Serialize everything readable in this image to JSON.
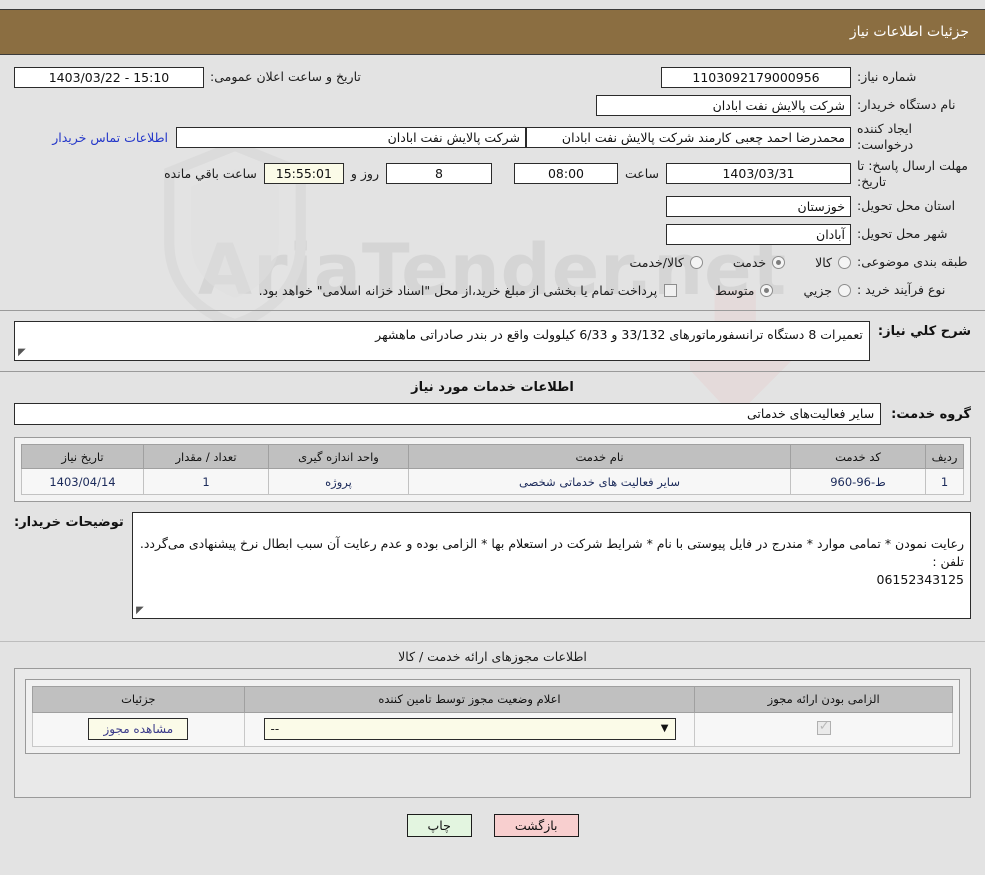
{
  "header": {
    "title": "جزئیات اطلاعات نیاز"
  },
  "watermark": {
    "text": "AriaTender.net"
  },
  "top_form": {
    "need_number_label": "شماره نیاز:",
    "need_number_value": "1103092179000956",
    "announce_label": "تاریخ و ساعت اعلان عمومی:",
    "announce_value": "15:10 - 1403/03/22",
    "buyer_org_label": "نام دستگاه خریدار:",
    "buyer_org_value": "شرکت پالایش نفت ابادان",
    "requester_label": "ایجاد کننده درخواست:",
    "requester_value": "محمدرضا احمد چعبی کارمند شرکت پالایش نفت ابادان",
    "buyer_org_repeat_value": "شرکت پالایش نفت ابادان",
    "contact_link": "اطلاعات تماس خریدار",
    "deadline_label": "مهلت ارسال پاسخ: تا تاریخ:",
    "deadline_date": "1403/03/31",
    "hour_label": "ساعت",
    "hour_value": "08:00",
    "days_value": "8",
    "days_label": "روز و",
    "countdown_value": "15:55:01",
    "countdown_label": "ساعت باقي مانده",
    "province_label": "استان محل تحویل:",
    "province_value": "خوزستان",
    "city_label": "شهر محل تحویل:",
    "city_value": "آبادان",
    "category_label": "طبقه بندی موضوعی:",
    "category_options": [
      {
        "label": "کالا",
        "selected": false
      },
      {
        "label": "خدمت",
        "selected": true
      },
      {
        "label": "کالا/خدمت",
        "selected": false
      }
    ],
    "process_label": "نوع فرآیند خرید :",
    "process_options": [
      {
        "label": "جزیي",
        "selected": false
      },
      {
        "label": "متوسط",
        "selected": true
      }
    ],
    "payment_checkbox_label": "پرداخت تمام یا بخشی از مبلغ خرید،از محل \"اسناد خزانه اسلامی\" خواهد بود.",
    "payment_checked": false
  },
  "description": {
    "label": "شرح کلي نیاز:",
    "value": "تعمیرات 8 دستگاه ترانسفورماتورهای 33/132 و 6/33 کیلوولت واقع در بندر صادراتی ماهشهر"
  },
  "services": {
    "section_title": "اطلاعات خدمات مورد نیاز",
    "group_label": "گروه خدمت:",
    "group_value": "سایر فعالیت‌های خدماتی",
    "columns": [
      "ردیف",
      "کد خدمت",
      "نام خدمت",
      "واحد اندازه گیری",
      "تعداد / مقدار",
      "تاریخ نیاز"
    ],
    "rows": [
      {
        "index": "1",
        "code": "ط-96-960",
        "name": "سایر فعالیت های خدماتی شخصی",
        "unit": "پروژه",
        "quantity": "1",
        "need_date": "1403/04/14"
      }
    ]
  },
  "buyer_notes": {
    "label": "توضیحات خریدار:",
    "value": "رعایت نمودن * تمامی موارد * مندرج در فایل پیوستی با نام * شرایط شرکت در استعلام بها * الزامی بوده و عدم رعایت آن سبب ابطال نرخ پیشنهادی می‌گردد.\nتلفن :\n06152343125"
  },
  "licenses": {
    "section_title": "اطلاعات مجوزهای ارائه خدمت / کالا",
    "columns": [
      "الزامی بودن ارائه مجوز",
      "اعلام وضعیت مجوز توسط تامین کننده",
      "جزئیات"
    ],
    "rows": [
      {
        "required_checked": true,
        "status_value": "--",
        "details_button": "مشاهده مجوز"
      }
    ]
  },
  "footer": {
    "back_button": "بازگشت",
    "print_button": "چاپ"
  }
}
